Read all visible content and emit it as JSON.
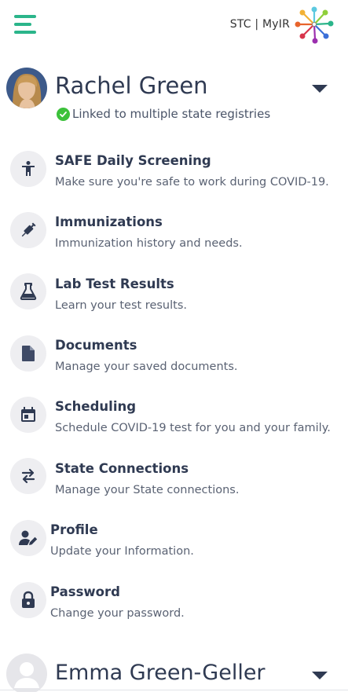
{
  "header": {
    "logo_text": "STC | MyIR",
    "colors": {
      "hamburger": "#2bb58a",
      "logo_dots": [
        "#f2b134",
        "#e8642c",
        "#d8344b",
        "#9b2fae",
        "#3b6fd8",
        "#2bb58a",
        "#5cc9e0",
        "#8fcf3a"
      ]
    }
  },
  "current_user": {
    "name": "Rachel Green",
    "linked_status": "Linked to multiple state registries"
  },
  "menu": [
    {
      "id": "safe",
      "title": "SAFE Daily Screening",
      "subtitle": "Make sure you're safe to work during COVID-19.",
      "icon": "person-standing-icon"
    },
    {
      "id": "immunizations",
      "title": "Immunizations",
      "subtitle": "Immunization history and needs.",
      "icon": "syringe-icon"
    },
    {
      "id": "lab",
      "title": "Lab Test Results",
      "subtitle": "Learn your test results.",
      "icon": "flask-icon"
    },
    {
      "id": "documents",
      "title": "Documents",
      "subtitle": "Manage your saved documents.",
      "icon": "document-icon"
    },
    {
      "id": "scheduling",
      "title": "Scheduling",
      "subtitle": "Schedule COVID-19 test for you and your family.",
      "icon": "calendar-icon"
    },
    {
      "id": "state",
      "title": "State Connections",
      "subtitle": "Manage your State connections.",
      "icon": "swap-arrows-icon"
    },
    {
      "id": "profile",
      "title": "Profile",
      "subtitle": "Update your Information.",
      "icon": "person-edit-icon"
    },
    {
      "id": "password",
      "title": "Password",
      "subtitle": "Change your password.",
      "icon": "lock-icon"
    }
  ],
  "other_user": {
    "name": "Emma Green-Geller"
  }
}
